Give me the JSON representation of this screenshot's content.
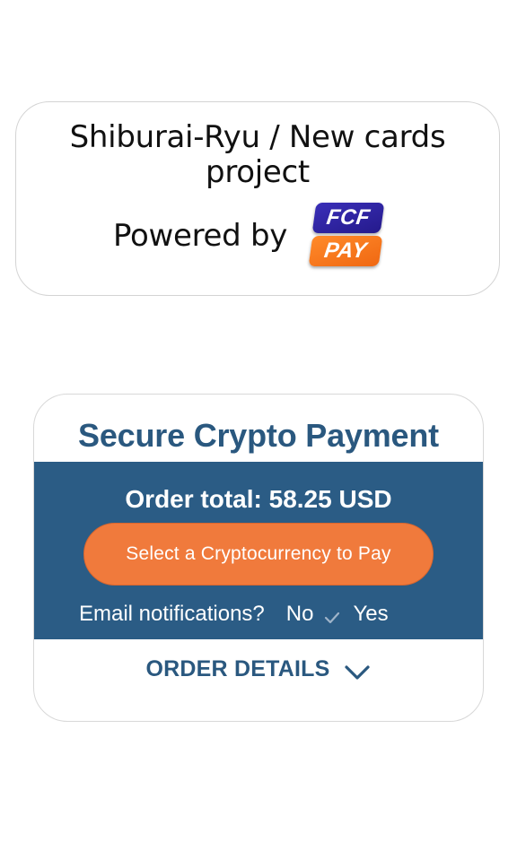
{
  "header": {
    "project_title": "Shiburai-Ryu / New cards project",
    "powered_by": "Powered by",
    "logo": {
      "top_text": "FCF",
      "bottom_text": "PAY",
      "top_color": "#2d21a3",
      "bottom_color": "#f47520"
    }
  },
  "payment": {
    "title": "Secure Crypto Payment",
    "order_total": "Order total: 58.25 USD",
    "pay_button_label": "Select a Cryptocurrency to Pay",
    "email_notifications": {
      "label": "Email notifications?",
      "no_label": "No",
      "yes_label": "Yes",
      "selected": "No"
    },
    "order_details_label": "ORDER DETAILS",
    "colors": {
      "title_blue": "#2a587f",
      "panel_blue": "#2b5c85",
      "button_orange": "#f07a3c"
    }
  },
  "icons": {
    "check": "check-icon",
    "chevron": "chevron-down-icon"
  }
}
